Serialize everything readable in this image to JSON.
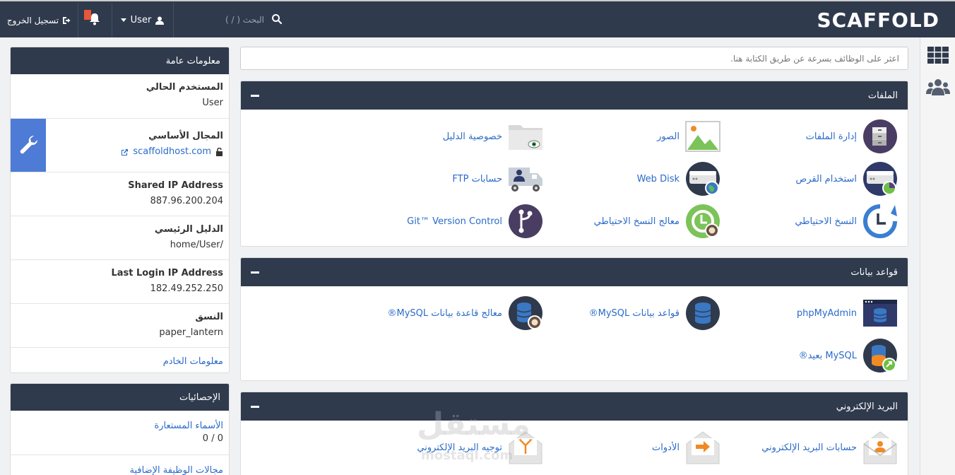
{
  "topbar": {
    "logo": "SCAFFOLD",
    "search_placeholder": "البحث ( / )",
    "user_label": "User",
    "logout_label": "تسجيل الخروج"
  },
  "function_search": {
    "placeholder": "اعثر على الوظائف بسرعة عن طريق الكتابة هنا."
  },
  "general_info": {
    "title": "معلومات عامة",
    "current_user_label": "المستخدم الحالي",
    "current_user_value": "User",
    "primary_domain_label": "المجال الأساسي",
    "primary_domain_value": "scaffoldhost.com",
    "shared_ip_label": "Shared IP Address",
    "shared_ip_value": "887.96.200.204",
    "home_dir_label": "الدليل الرئيسي",
    "home_dir_value": "/home/User",
    "last_login_label": "Last Login IP Address",
    "last_login_value": "182.49.252.250",
    "theme_label": "النسق",
    "theme_value": "paper_lantern",
    "server_info_link": "معلومات الخادم"
  },
  "stats": {
    "title": "الإحصائيات",
    "aliases_label": "الأسماء المستعارة",
    "aliases_value": "0 / 0",
    "addon_domains_label": "مجالات الوظيفة الإضافية"
  },
  "sections": {
    "files": {
      "title": "الملفات",
      "items": [
        "إدارة الملفات",
        "الصور",
        "خصوصية الدليل",
        "استخدام القرص",
        "Web Disk",
        "حسابات FTP",
        "النسخ الاحتياطي",
        "معالج النسخ الاحتياطي",
        "Git™ Version Control"
      ]
    },
    "databases": {
      "title": "قواعد بيانات",
      "items": [
        "phpMyAdmin",
        "قواعد بيانات MySQL®",
        "معالج قاعدة بيانات MySQL®",
        "MySQL بعيد®"
      ]
    },
    "email": {
      "title": "البريد الإلكتروني",
      "items": [
        "حسابات البريد الإلكتروني",
        "الأدوات",
        "توجيه البريد الإلكتروني"
      ]
    }
  },
  "watermark": {
    "arabic": "مستقل",
    "latin": "mostaql.com"
  },
  "colors": {
    "topbar": "#2f3a4d",
    "link": "#2a6bc8",
    "accent": "#4d7bd6"
  }
}
